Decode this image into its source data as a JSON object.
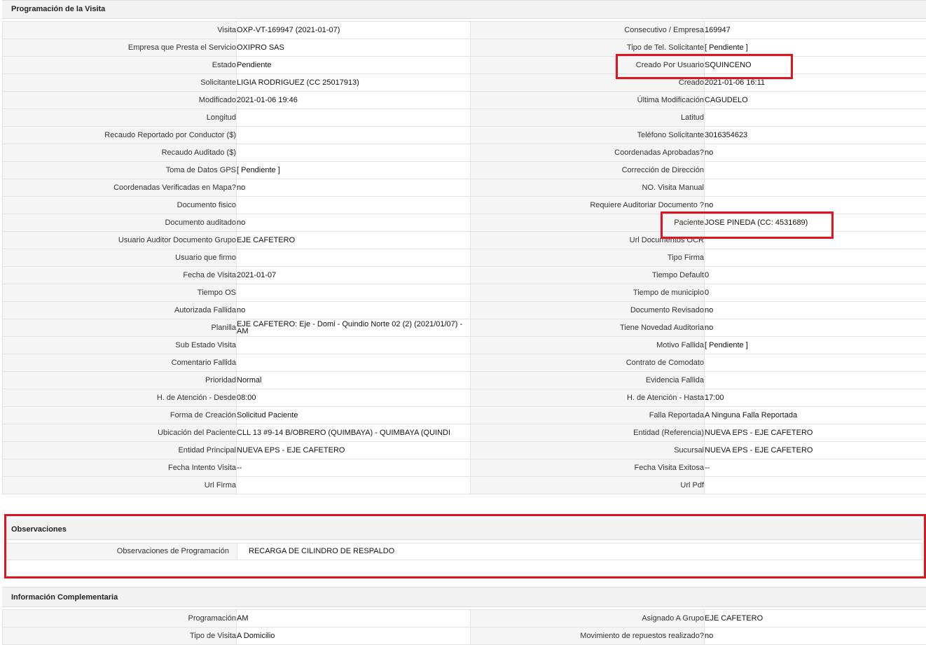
{
  "programacion": {
    "title": "Programación de la Visita",
    "rows": [
      {
        "l1": "Visita",
        "v1": "OXP-VT-169947 (2021-01-07)",
        "l2": "Consecutivo / Empresa",
        "v2": "169947"
      },
      {
        "l1": "Empresa que Presta el Servicio",
        "v1": "OXIPRO SAS",
        "l2": "Tipo de Tel. Solicitante",
        "v2": "[ Pendiente ]"
      },
      {
        "l1": "Estado",
        "v1": "Pendiente",
        "l2": "Creado Por Usuario",
        "v2": "SQUINCENO"
      },
      {
        "l1": "Solicitante",
        "v1": "LIGIA RODRIGUEZ (CC 25017913)",
        "l2": "Creado",
        "v2": "2021-01-06 16:11"
      },
      {
        "l1": "Modificado",
        "v1": "2021-01-06 19:46",
        "l2": "Última Modificación",
        "v2": " CAGUDELO"
      },
      {
        "l1": "Longitud",
        "v1": "",
        "l2": "Latitud",
        "v2": ""
      },
      {
        "l1": "Recaudo Reportado por Conductor ($)",
        "v1": "",
        "l2": "Teléfono Solicitante",
        "v2": "3016354623"
      },
      {
        "l1": "Recaudo Auditado ($)",
        "v1": "",
        "l2": "Coordenadas Aprobadas?",
        "v2": " no"
      },
      {
        "l1": "Toma de Datos GPS",
        "v1": "[ Pendiente ]",
        "l2": "Corrección de Dirección",
        "v2": ""
      },
      {
        "l1": "Coordenadas Verificadas en Mapa?",
        "v1": " no",
        "l2": "NO. Visita Manual",
        "v2": ""
      },
      {
        "l1": "Documento fisico",
        "v1": "",
        "l2": "Requiere Auditoriar Documento ?",
        "v2": " no"
      },
      {
        "l1": "Documento auditado",
        "v1": " no",
        "l2": "Paciente",
        "v2": "JOSE PINEDA (CC: 4531689)"
      },
      {
        "l1": "Usuario Auditor Documento Grupo",
        "v1": "EJE CAFETERO",
        "l2": "Url Documentos OCR",
        "v2": ""
      },
      {
        "l1": "Usuario que firmo",
        "v1": "",
        "l2": "Tipo Firma",
        "v2": ""
      },
      {
        "l1": "Fecha de Visita",
        "v1": " 2021-01-07",
        "l2": "Tiempo Default",
        "v2": "0"
      },
      {
        "l1": "Tiempo OS",
        "v1": "",
        "l2": "Tiempo de municipio",
        "v2": "0"
      },
      {
        "l1": "Autorizada Fallida",
        "v1": " no",
        "l2": "Documento Revisado",
        "v2": " no"
      },
      {
        "l1": "Planilla",
        "v1": "EJE CAFETERO: Eje - Domi - Quindio Norte 02 (2) (2021/01/07) - AM",
        "l2": "Tiene Novedad Auditoria",
        "v2": " no"
      },
      {
        "l1": "Sub Estado Visita",
        "v1": "",
        "l2": "Motivo Fallida",
        "v2": "[ Pendiente ]"
      },
      {
        "l1": "Comentario Fallida",
        "v1": "",
        "l2": "Contrato de Comodato",
        "v2": ""
      },
      {
        "l1": "Prioridad",
        "v1": "Normal",
        "l2": "Evidencia Fallida",
        "v2": ""
      },
      {
        "l1": "H. de Atención - Desde",
        "v1": "08:00",
        "l2": "H. de Atención - Hasta",
        "v2": "17:00"
      },
      {
        "l1": "Forma de Creación",
        "v1": "Solicitud Paciente",
        "l2": "Falla Reportada",
        "v2": "A Ninguna Falla Reportada"
      },
      {
        "l1": "Ubicación del Paciente",
        "v1": "CLL 13 #9-14 B/OBRERO (QUIMBAYA) - QUIMBAYA (QUINDI",
        "l2": "Entidad (Referencia)",
        "v2": "NUEVA EPS - EJE CAFETERO"
      },
      {
        "l1": "Entidad Principal",
        "v1": "NUEVA EPS - EJE CAFETERO",
        "l2": "Sucursal",
        "v2": "NUEVA EPS - EJE CAFETERO"
      },
      {
        "l1": "Fecha Intento Visita",
        "v1": " --",
        "l2": "Fecha Visita Exitosa",
        "v2": " --"
      },
      {
        "l1": "Url Firma",
        "v1": "",
        "l2": "Url Pdf",
        "v2": ""
      }
    ]
  },
  "observaciones": {
    "title": "Observaciones",
    "label": "Observaciones de Programación",
    "value": "RECARGA DE CILINDRO DE RESPALDO"
  },
  "complementaria": {
    "title": "Información Complementaria",
    "rows": [
      {
        "l1": "Programación",
        "v1": "AM",
        "l2": "Asignado A Grupo",
        "v2": "EJE CAFETERO"
      },
      {
        "l1": "Tipo de Visita",
        "v1": "A Domicilio",
        "l2": "Movimiento de repuestos realizado?",
        "v2": " no"
      }
    ]
  },
  "highlight_color": "#e0141e"
}
